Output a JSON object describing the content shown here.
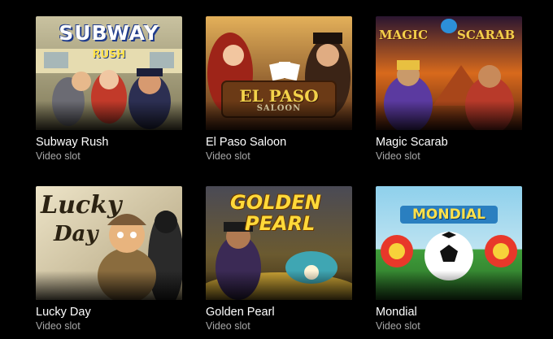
{
  "games": [
    {
      "title": "Subway Rush",
      "subtitle": "Video slot",
      "logo_line1": "SUBWAY",
      "logo_line2": "RUSH"
    },
    {
      "title": "El Paso Saloon",
      "subtitle": "Video slot",
      "logo_line1": "EL PASO",
      "logo_line2": "SALOON"
    },
    {
      "title": "Magic Scarab",
      "subtitle": "Video slot",
      "logo_line1": "MAGIC",
      "logo_line2": "SCARAB"
    },
    {
      "title": "Lucky Day",
      "subtitle": "Video slot",
      "logo_line1": "Lucky",
      "logo_line2": "Day"
    },
    {
      "title": "Golden Pearl",
      "subtitle": "Video slot",
      "logo_line1": "GOLDEN",
      "logo_line2": "PEARL"
    },
    {
      "title": "Mondial",
      "subtitle": "Video slot",
      "logo_line1": "MONDIAL",
      "logo_line2": ""
    }
  ],
  "colors": {
    "background": "#000000",
    "title": "#ffffff",
    "subtitle": "#a8a8a8"
  }
}
